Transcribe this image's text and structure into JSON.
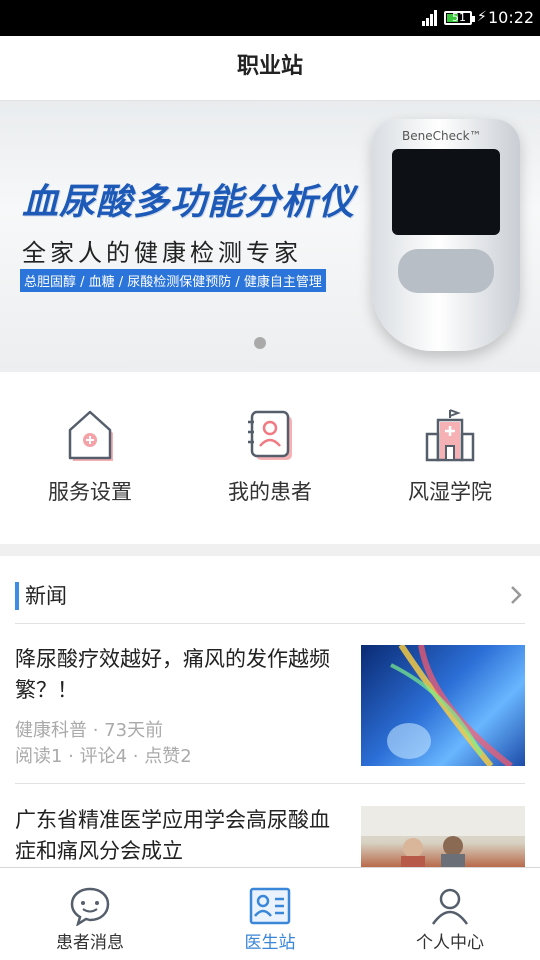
{
  "status_bar": {
    "battery_level": "51",
    "time": "10:22"
  },
  "header": {
    "title": "职业站"
  },
  "banner": {
    "headline": "血尿酸多功能分析仪",
    "subtitle": "全家人的健康检测专家",
    "tagline": "总胆固醇 / 血糖 / 尿酸检测保健预防 / 健康自主管理",
    "device_brand": "BeneCheck™",
    "carousel_index": 1,
    "carousel_count": 1
  },
  "quick_nav": {
    "items": [
      {
        "label": "服务设置",
        "icon": "house-plus-icon"
      },
      {
        "label": "我的患者",
        "icon": "patient-book-icon"
      },
      {
        "label": "风湿学院",
        "icon": "hospital-building-icon"
      }
    ]
  },
  "news": {
    "section_title": "新闻",
    "items": [
      {
        "headline": "降尿酸疗效越好，痛风的发作越频繁？！",
        "category_time": "健康科普 · 73天前",
        "stats": "阅读1 · 评论4 · 点赞2"
      },
      {
        "headline": "广东省精准医学应用学会高尿酸血症和痛风分会成立"
      }
    ]
  },
  "tab_bar": {
    "tabs": [
      {
        "label": "患者消息",
        "icon": "chat-bubble-icon",
        "active": false
      },
      {
        "label": "医生站",
        "icon": "id-card-icon",
        "active": true
      },
      {
        "label": "个人中心",
        "icon": "person-icon",
        "active": false
      }
    ],
    "accent_color": "#3a86d8"
  },
  "colors": {
    "accent": "#3a86d8",
    "banner_title": "#1d5ab8",
    "icon_pink": "#f4a3a8"
  }
}
